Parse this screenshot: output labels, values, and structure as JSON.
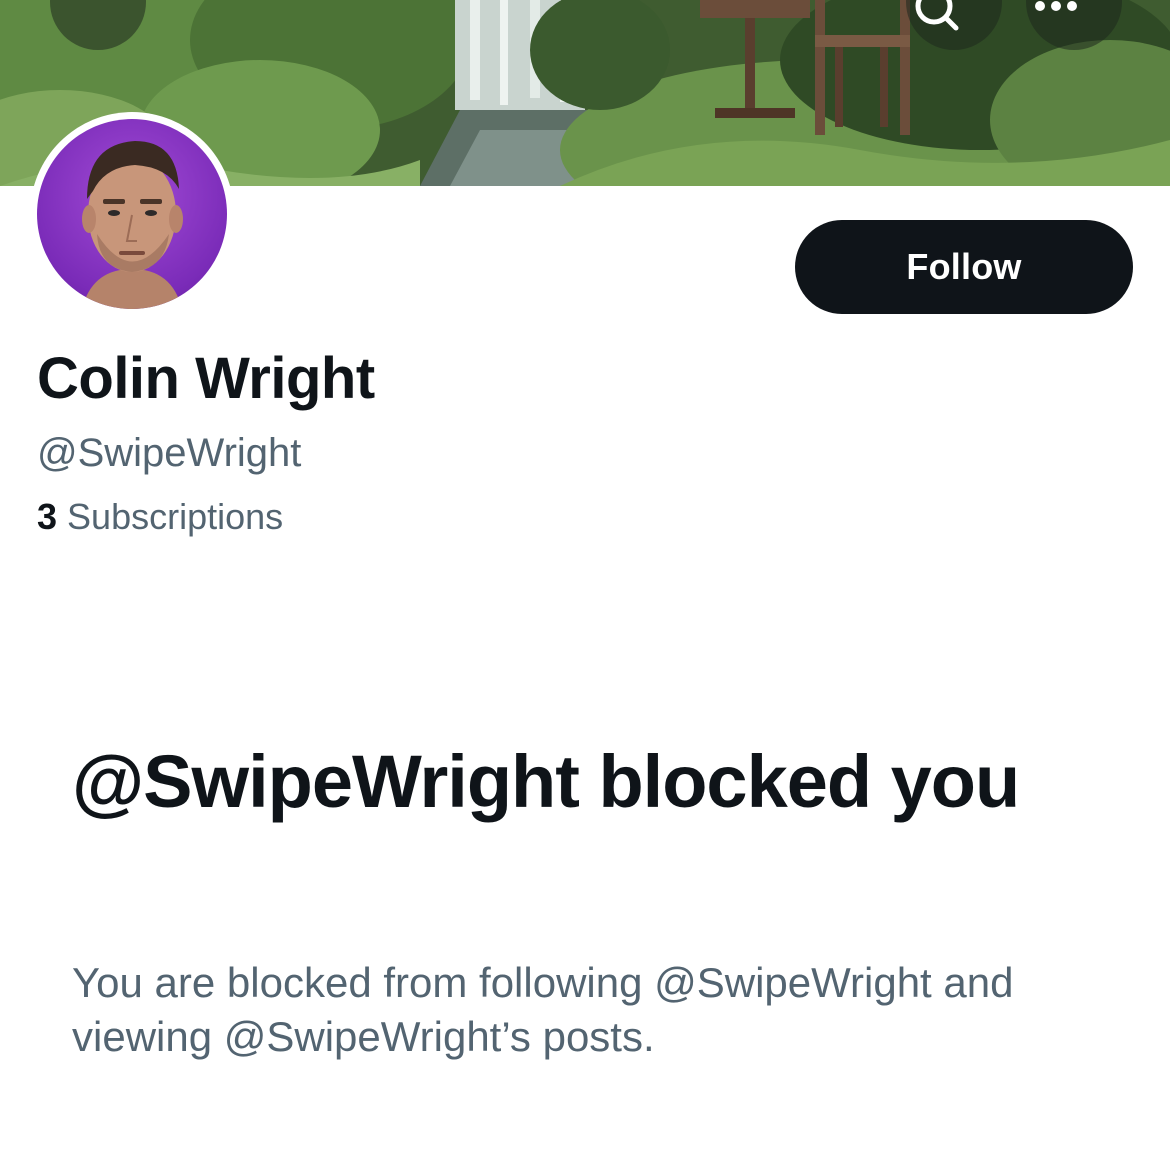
{
  "header": {
    "back_icon": "arrow-left-icon",
    "search_icon": "search-icon",
    "more_icon": "more-horizontal-icon"
  },
  "profile": {
    "display_name": "Colin Wright",
    "handle": "@SwipeWright",
    "subscriptions_count": "3",
    "subscriptions_label": "Subscriptions",
    "follow_label": "Follow"
  },
  "blocked": {
    "title": "@SwipeWright blocked you",
    "description": "You are blocked from following @SwipeWright and viewing @SwipeWright’s posts."
  },
  "colors": {
    "primary_text": "#0f1419",
    "secondary_text": "#536471",
    "button_bg": "#0f1419",
    "avatar_bg": "#7a2bb8"
  }
}
